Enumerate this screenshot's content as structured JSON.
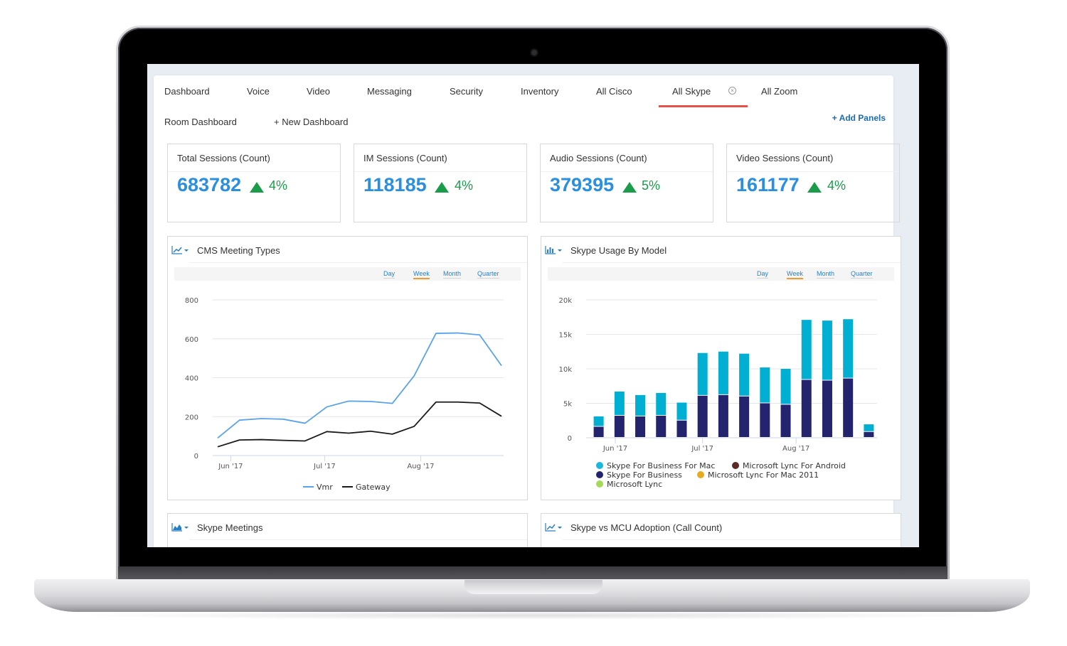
{
  "tabs": [
    {
      "label": "Dashboard"
    },
    {
      "label": "Voice"
    },
    {
      "label": "Video"
    },
    {
      "label": "Messaging"
    },
    {
      "label": "Security"
    },
    {
      "label": "Inventory"
    },
    {
      "label": "All Cisco"
    },
    {
      "label": "All Skype",
      "active": true,
      "closable": true
    },
    {
      "label": "All Zoom"
    }
  ],
  "row2": {
    "room_dashboard": "Room Dashboard",
    "new_dashboard": "+ New Dashboard",
    "add_panels": "+ Add Panels"
  },
  "kpis": [
    {
      "title": "Total Sessions (Count)",
      "value": "683782",
      "trend": "up",
      "change": "4%"
    },
    {
      "title": "IM Sessions (Count)",
      "value": "118185",
      "trend": "up",
      "change": "4%"
    },
    {
      "title": "Audio Sessions (Count)",
      "value": "379395",
      "trend": "up",
      "change": "5%"
    },
    {
      "title": "Video Sessions (Count)",
      "value": "161177",
      "trend": "up",
      "change": "4%"
    }
  ],
  "colors": {
    "accent": "#2b8fe0",
    "positive": "#1a9c4a",
    "active_tab": "#e8504a",
    "active_range": "#f29a2e",
    "link": "#1a6bb5"
  },
  "panels": {
    "cms": {
      "title": "CMS Meeting Types",
      "type_icon": "line-chart-icon"
    },
    "usage": {
      "title": "Skype Usage By Model",
      "type_icon": "bar-chart-icon"
    },
    "meetings": {
      "title": "Skype Meetings",
      "type_icon": "area-chart-icon"
    },
    "adoption": {
      "title": "Skype vs MCU Adoption (Call Count)",
      "type_icon": "line-chart-icon"
    }
  },
  "ranges": [
    "Day",
    "Week",
    "Month",
    "Quarter"
  ],
  "active_range": "Week",
  "chart_data": [
    {
      "type": "line",
      "title": "CMS Meeting Types",
      "xlabel": "",
      "ylabel": "",
      "ylim": [
        0,
        800
      ],
      "yticks": [
        "0",
        "200",
        "400",
        "600",
        "800"
      ],
      "xticks": [
        {
          "label": "Jun '17",
          "index": 0.6
        },
        {
          "label": "Jul '17",
          "index": 4.9
        },
        {
          "label": "Aug '17",
          "index": 9.3
        }
      ],
      "grid": true,
      "legend": "bottom",
      "series": [
        {
          "name": "Vmr",
          "color": "#5aa3e8",
          "values": [
            90,
            182,
            190,
            187,
            166,
            250,
            280,
            278,
            268,
            410,
            628,
            630,
            620,
            462
          ]
        },
        {
          "name": "Gateway",
          "color": "#1a1a1a",
          "values": [
            45,
            80,
            82,
            78,
            75,
            123,
            115,
            125,
            110,
            150,
            275,
            275,
            270,
            202
          ]
        }
      ]
    },
    {
      "type": "bar",
      "stacked": true,
      "title": "Skype Usage By Model",
      "xlabel": "",
      "ylabel": "",
      "ylim": [
        0,
        20000
      ],
      "yticks": [
        "0",
        "5k",
        "10k",
        "15k",
        "20k"
      ],
      "xticks": [
        {
          "label": "Jun '17",
          "index": 0.8
        },
        {
          "label": "Jul '17",
          "index": 5
        },
        {
          "label": "Aug '17",
          "index": 9.5
        }
      ],
      "grid": true,
      "legend": "bottom",
      "series": [
        {
          "name": "Skype For Business",
          "color": "#23236e",
          "values": [
            1600,
            3200,
            3100,
            3200,
            2500,
            6100,
            6200,
            6000,
            5000,
            4800,
            8400,
            8300,
            8600,
            850
          ]
        },
        {
          "name": "Skype For Business For Mac",
          "color": "#00afd1",
          "values": [
            1500,
            3500,
            3100,
            3300,
            2600,
            6200,
            6300,
            6200,
            5200,
            5200,
            8700,
            8700,
            8600,
            1100
          ]
        }
      ],
      "legend_entries": [
        {
          "name": "Skype For Business For Mac",
          "color": "#1ab7dc"
        },
        {
          "name": "Microsoft Lync For Android",
          "color": "#5a2a26"
        },
        {
          "name": "Skype For Business",
          "color": "#23236e"
        },
        {
          "name": "Microsoft Lync For Mac 2011",
          "color": "#e6ac1f"
        },
        {
          "name": "Microsoft Lync",
          "color": "#a6d85a"
        }
      ]
    }
  ]
}
